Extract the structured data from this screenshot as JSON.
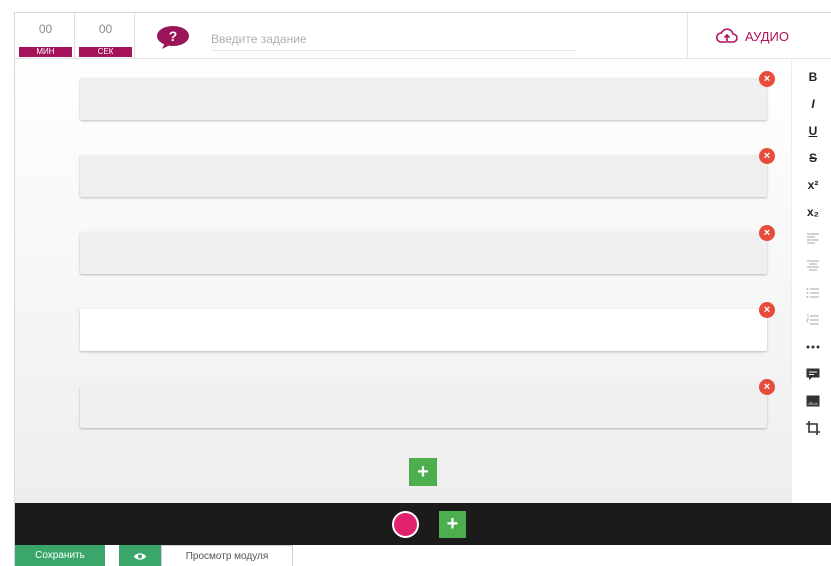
{
  "timer": {
    "minutes": {
      "value": "00",
      "unit": "МИН"
    },
    "seconds": {
      "value": "00",
      "unit": "СЕК"
    }
  },
  "task": {
    "placeholder": "Введите задание",
    "value": ""
  },
  "audio": {
    "label": "АУДИО"
  },
  "answers": [
    {
      "active": false
    },
    {
      "active": false
    },
    {
      "active": false
    },
    {
      "active": true
    },
    {
      "active": false
    }
  ],
  "toolbar": {
    "bold": "B",
    "italic": "I",
    "underline": "U",
    "strike": "S",
    "superscript": "x²",
    "subscript": "x₂"
  },
  "footer": {
    "save_label": "Сохранить",
    "preview_label": "Просмотр модуля"
  },
  "colors": {
    "brand": "#a5125a",
    "accent_green": "#4cae4c",
    "remove_red": "#e74c3c",
    "record_pink": "#e2226f"
  }
}
